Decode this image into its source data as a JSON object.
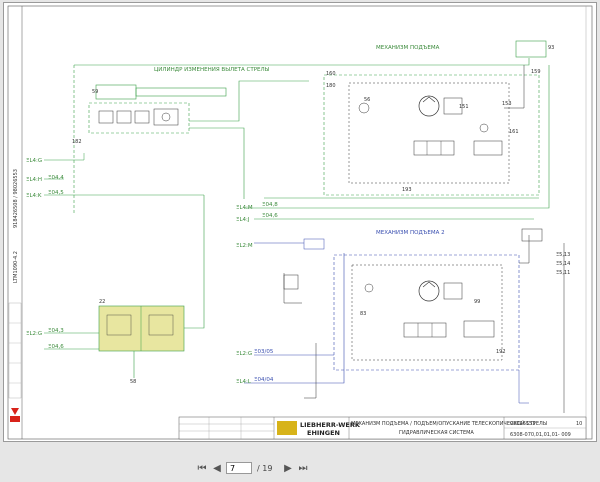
{
  "viewer": {
    "current_page": "7",
    "page_total": "/ 19",
    "first_icon": "first-page-icon",
    "prev_icon": "prev-page-icon",
    "next_icon": "next-page-icon",
    "last_icon": "last-page-icon"
  },
  "sheet": {
    "side_code_1": "LTM1090-4.2",
    "side_code_2": "918426508 / 98026553",
    "title_cylinder": "ЦИЛИНДР ИЗМЕНЕНИЯ ВЫЛЕТА СТРЕЛЫ",
    "title_hoist1": "МЕХАНИЗМ ПОДЪЕМА",
    "title_hoist2": "МЕХАНИЗМ ПОДЪЕМА 2",
    "component_22": "22",
    "component_182": "182",
    "component_160": "160",
    "component_193": "193",
    "component_151": "151",
    "component_153": "153",
    "component_159": "159",
    "component_161": "161",
    "component_56": "56",
    "component_59": "59",
    "component_58": "58",
    "component_192": "192",
    "component_83": "83",
    "component_99": "99",
    "left_lines": [
      "ΞL4:G",
      "ΞL4:H",
      "ΞL4:K",
      "ΞL4:M",
      "ΞL4:J",
      "ΞL2:M",
      "ΞL2:G",
      "ΞL4:L",
      "ΞL2:G"
    ],
    "pipe_labels_green": [
      "Ξ04,4",
      "Ξ04,5",
      "Ξ04,6",
      "Ξ04,8",
      "Ξ04,3",
      "Ξ04,6"
    ],
    "pipe_labels_blue": [
      "Ξ03/05",
      "Ξ04/04"
    ],
    "label_right_1": "Ξ5,13",
    "label_right_2": "Ξ5,14",
    "label_right_3": "Ξ5,11",
    "brand": {
      "company_line1": "LIEBHERR-WERK",
      "company_line2": "EHINGEN"
    },
    "title_block": {
      "desc_line1": "МЕХАНИЗМ ПОДЪЕМА / ПОДЪЕМ/ОПУСКАНИЕ ТЕЛЕСКОПИЧЕСКОЙ СТРЕЛЫ",
      "desc_line2": "ГИДРАВЛИЧЕСКАЯ СИСТЕМА",
      "doc_no": "98026553",
      "drawing_no": "6308-070,01,01,01- 009",
      "page_ref": "10"
    }
  },
  "colors": {
    "green": "#3aa14a",
    "blue": "#3a4fb0",
    "yellow_block": "#e8e6a0",
    "red": "#d8231a"
  }
}
